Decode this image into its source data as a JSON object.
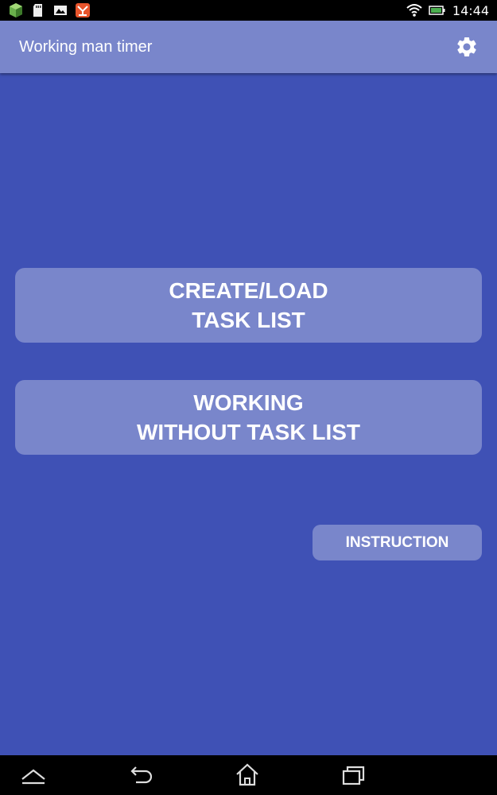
{
  "status_bar": {
    "time": "14:44",
    "left_icons": [
      "app-icon-green",
      "sd-card-icon",
      "image-icon",
      "app-icon-orange"
    ],
    "right_icons": [
      "wifi-icon",
      "battery-icon"
    ]
  },
  "app_bar": {
    "title": "Working man timer",
    "settings_icon": "gear-icon"
  },
  "main": {
    "create_button": {
      "line1": "CREATE/LOAD",
      "line2": "TASK LIST"
    },
    "working_button": {
      "line1": "WORKING",
      "line2": "WITHOUT TASK LIST"
    },
    "instruction_button": "INSTRUCTION"
  },
  "nav_bar": {
    "icons": [
      "chevron-up-icon",
      "back-icon",
      "home-icon",
      "recents-icon"
    ]
  },
  "colors": {
    "background": "#3f51b5",
    "accent": "#7986cb",
    "text": "#ffffff"
  }
}
